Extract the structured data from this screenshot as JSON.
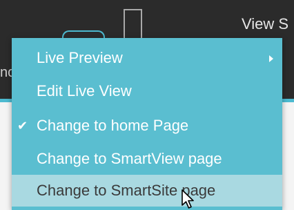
{
  "header": {
    "view_label": "View S",
    "partial_letters": "nc"
  },
  "context_menu": {
    "items": [
      {
        "label": "Live Preview",
        "has_submenu": true,
        "checked": false,
        "hovered": false
      },
      {
        "label": "Edit Live View",
        "has_submenu": false,
        "checked": false,
        "hovered": false
      },
      {
        "label": "Change to home Page",
        "has_submenu": false,
        "checked": true,
        "hovered": false
      },
      {
        "label": "Change to SmartView page",
        "has_submenu": false,
        "checked": false,
        "hovered": false
      },
      {
        "label": "Change to SmartSite page",
        "has_submenu": false,
        "checked": false,
        "hovered": true
      }
    ],
    "checkmark_glyph": "✔"
  },
  "colors": {
    "topbar": "#2b2b2b",
    "menu_background": "#5abed0",
    "menu_hover": "#a9d9e1",
    "accent": "#4cbad0"
  },
  "icons": {
    "submenu": "chevron-right-icon",
    "check": "check-icon",
    "cursor": "mouse-pointer-icon"
  }
}
